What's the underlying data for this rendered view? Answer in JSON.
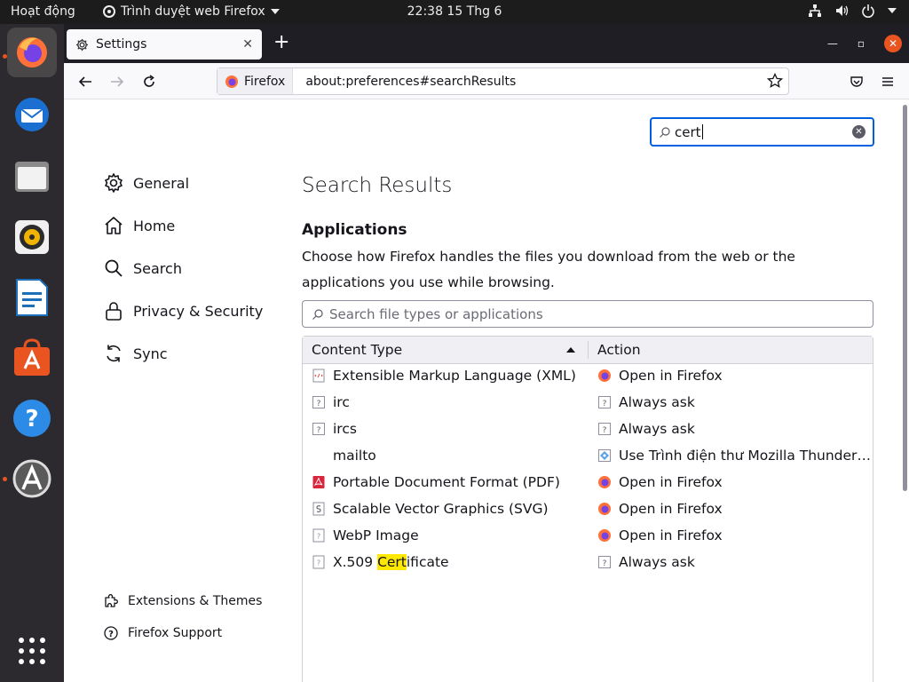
{
  "topbar": {
    "activities": "Hoạt động",
    "app_name": "Trình duyệt web Firefox",
    "clock": "22:38  15 Thg 6"
  },
  "tab": {
    "title": "Settings"
  },
  "urlbar": {
    "identity_label": "Firefox",
    "url": "about:preferences#searchResults"
  },
  "search": {
    "value": "cert"
  },
  "sidebar": {
    "items": [
      {
        "label": "General",
        "icon": "gear-icon"
      },
      {
        "label": "Home",
        "icon": "home-icon"
      },
      {
        "label": "Search",
        "icon": "search-icon"
      },
      {
        "label": "Privacy & Security",
        "icon": "lock-icon"
      },
      {
        "label": "Sync",
        "icon": "sync-icon"
      }
    ],
    "footer": [
      {
        "label": "Extensions & Themes",
        "icon": "puzzle-icon"
      },
      {
        "label": "Firefox Support",
        "icon": "help-icon"
      }
    ]
  },
  "main": {
    "heading": "Search Results",
    "section_title": "Applications",
    "description": "Choose how Firefox handles the files you download from the web or the applications you use while browsing.",
    "filter_placeholder": "Search file types or applications",
    "columns": {
      "type": "Content Type",
      "action": "Action"
    },
    "rows": [
      {
        "type": "Extensible Markup Language (XML)",
        "type_icon": "xml-file-icon",
        "action": "Open in Firefox",
        "action_icon": "firefox-icon"
      },
      {
        "type": "irc",
        "type_icon": "unknown-file-icon",
        "action": "Always ask",
        "action_icon": "ask-icon"
      },
      {
        "type": "ircs",
        "type_icon": "unknown-file-icon",
        "action": "Always ask",
        "action_icon": "ask-icon"
      },
      {
        "type": "mailto",
        "type_icon": "",
        "action": "Use Trình điện thư Mozilla Thunderbird",
        "action_icon": "thunderbird-icon"
      },
      {
        "type": "Portable Document Format (PDF)",
        "type_icon": "pdf-file-icon",
        "action": "Open in Firefox",
        "action_icon": "firefox-icon"
      },
      {
        "type": "Scalable Vector Graphics (SVG)",
        "type_icon": "svg-file-icon",
        "action": "Open in Firefox",
        "action_icon": "firefox-icon"
      },
      {
        "type": "WebP Image",
        "type_icon": "generic-file-icon",
        "action": "Open in Firefox",
        "action_icon": "firefox-icon"
      },
      {
        "type_pre": "X.509 ",
        "type_mark": "Cert",
        "type_post": "ificate",
        "type_icon": "generic-file-icon",
        "action": "Always ask",
        "action_icon": "ask-icon"
      }
    ]
  },
  "colors": {
    "accent": "#0061e0",
    "highlight": "#ffe900",
    "ubuntu_orange": "#e95420"
  }
}
